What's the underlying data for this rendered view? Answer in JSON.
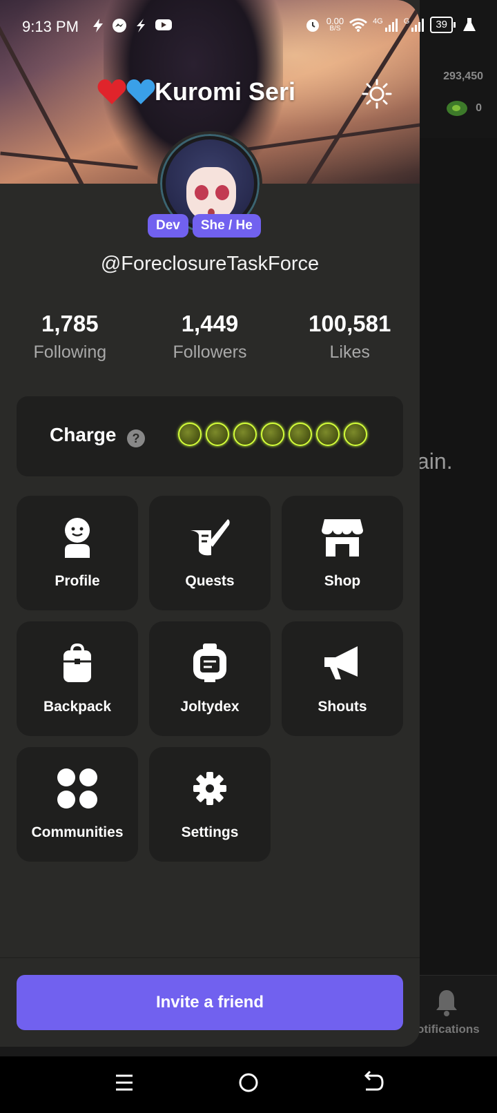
{
  "status_bar": {
    "time": "9:13 PM",
    "net_speed": "0.00",
    "net_unit": "B/S",
    "net_4g": "4G",
    "net_g": "G",
    "battery": "39"
  },
  "background_app": {
    "coins": "293,450",
    "energy": "0",
    "partial_text": "ain.",
    "notifications_label": "otifications"
  },
  "drawer": {
    "display_name": "Kuromi Seri",
    "badges": [
      "Dev",
      "She / He"
    ],
    "username": "@ForeclosureTaskForce",
    "stats": [
      {
        "value": "1,785",
        "label": "Following"
      },
      {
        "value": "1,449",
        "label": "Followers"
      },
      {
        "value": "100,581",
        "label": "Likes"
      }
    ],
    "charge": {
      "label": "Charge",
      "help": "?",
      "orb_count": 7
    },
    "menu": [
      {
        "label": "Profile",
        "icon": "profile-icon"
      },
      {
        "label": "Quests",
        "icon": "quests-icon"
      },
      {
        "label": "Shop",
        "icon": "shop-icon"
      },
      {
        "label": "Backpack",
        "icon": "backpack-icon"
      },
      {
        "label": "Joltydex",
        "icon": "joltydex-icon"
      },
      {
        "label": "Shouts",
        "icon": "megaphone-icon"
      },
      {
        "label": "Communities",
        "icon": "communities-icon"
      },
      {
        "label": "Settings",
        "icon": "gear-icon"
      }
    ],
    "invite_label": "Invite a friend"
  },
  "colors": {
    "accent": "#7161ef",
    "drawer_bg": "#2a2a28",
    "tile_bg": "#1f1f1e"
  }
}
